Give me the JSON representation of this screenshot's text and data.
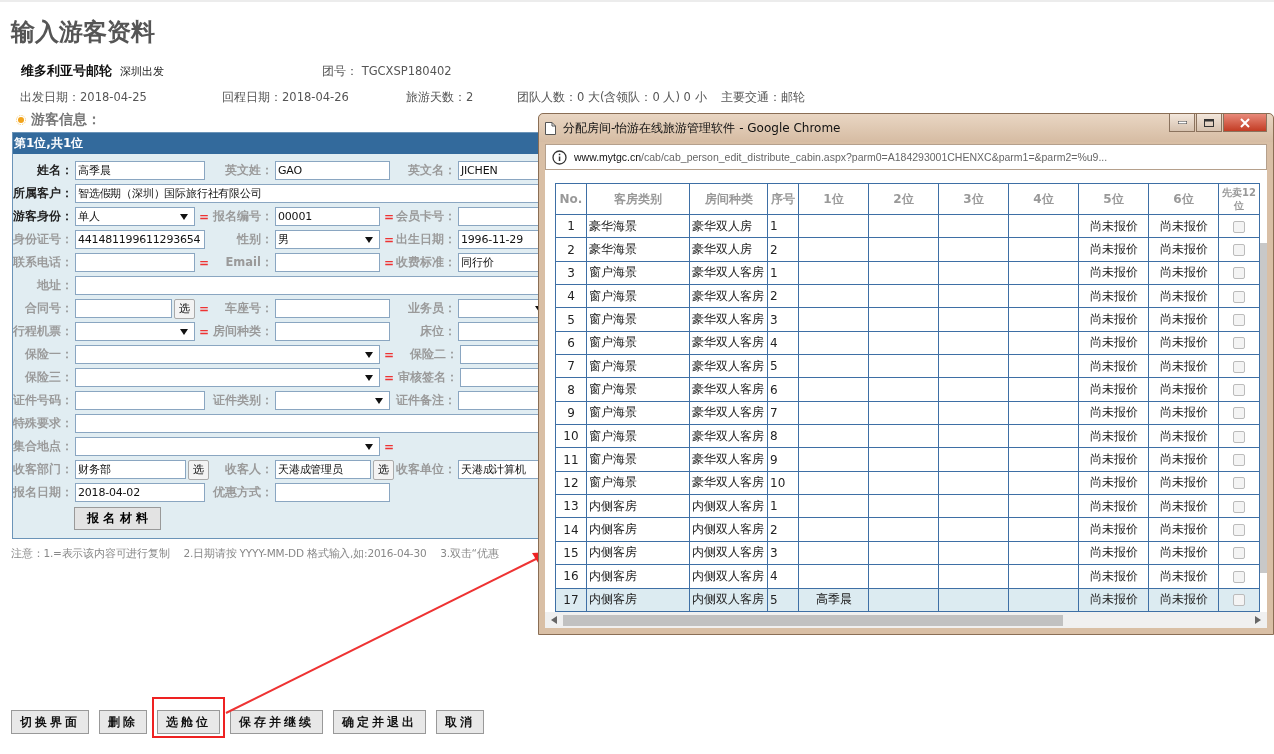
{
  "page_title": "输入游客资料",
  "tour": {
    "ship": "维多利亚号邮轮",
    "departure_city": "深圳出发",
    "group_no": "团号： TGCXSP180402",
    "facts": [
      "出发日期：2018-04-25",
      "回程日期：2018-04-26",
      "旅游天数：2",
      "团队人数：0 大(含领队：0 人) 0 小",
      "主要交通：邮轮"
    ]
  },
  "section_title": "游客信息：",
  "form": {
    "header": "第1位,共1位",
    "rows": [
      [
        {
          "label": "姓名：",
          "required": true,
          "kind": "text",
          "value": "高季晨"
        },
        {
          "label": "英文姓：",
          "required": false,
          "kind": "text",
          "value": "GAO"
        },
        {
          "label": "英文名：",
          "required": false,
          "kind": "text",
          "value": "JICHEN"
        }
      ],
      [
        {
          "label": "所属客户：",
          "required": true,
          "kind": "long_text",
          "value": "智选假期（深圳）国际旅行社有限公司"
        }
      ],
      [
        {
          "label": "游客身份：",
          "required": true,
          "kind": "select",
          "value": "单人",
          "eq": "="
        },
        {
          "label": "报名编号：",
          "required": false,
          "kind": "text",
          "value": "00001",
          "eq": "="
        },
        {
          "label": "会员卡号：",
          "required": false,
          "kind": "text"
        }
      ],
      [
        {
          "label": "身份证号：",
          "required": false,
          "kind": "text",
          "value": "441481199611293654"
        },
        {
          "label": "性别：",
          "required": false,
          "kind": "select",
          "value": "男",
          "eq": "="
        },
        {
          "label": "出生日期：",
          "required": false,
          "kind": "text",
          "value": "1996-11-29"
        }
      ],
      [
        {
          "label": "联系电话：",
          "required": false,
          "kind": "text",
          "eq": "="
        },
        {
          "label": "Email：",
          "required": false,
          "kind": "text",
          "eq": "="
        },
        {
          "label": "收费标准：",
          "required": false,
          "kind": "text",
          "value": "同行价"
        }
      ],
      [
        {
          "label": "地址：",
          "required": false,
          "kind": "long_text"
        }
      ],
      [
        {
          "label": "合同号：",
          "required": false,
          "kind": "text",
          "pick": "选",
          "eq": "="
        },
        {
          "label": "车座号：",
          "required": false,
          "kind": "text"
        },
        {
          "label": "业务员：",
          "required": false,
          "kind": "select"
        }
      ],
      [
        {
          "label": "行程机票：",
          "required": false,
          "kind": "select",
          "eq": "="
        },
        {
          "label": "房间种类：",
          "required": false,
          "kind": "text"
        },
        {
          "label": "床位：",
          "required": false,
          "kind": "text"
        }
      ],
      [
        {
          "label": "保险一：",
          "required": false,
          "kind": "long_select",
          "eq": "="
        },
        {
          "label": "保险二：",
          "required": false,
          "kind": "text"
        }
      ],
      [
        {
          "label": "保险三：",
          "required": false,
          "kind": "long_select",
          "eq": "="
        },
        {
          "label": "审核签名：",
          "required": false,
          "kind": "text"
        }
      ],
      [
        {
          "label": "证件号码：",
          "required": false,
          "kind": "text"
        },
        {
          "label": "证件类别：",
          "required": false,
          "kind": "select"
        },
        {
          "label": "证件备注：",
          "required": false,
          "kind": "text"
        }
      ],
      [
        {
          "label": "特殊要求：",
          "required": false,
          "kind": "long_text"
        }
      ],
      [
        {
          "label": "集合地点：",
          "required": false,
          "kind": "long_select",
          "eq": "="
        }
      ],
      [
        {
          "label": "收客部门：",
          "required": false,
          "kind": "text",
          "value": "财务部",
          "pick": "选"
        },
        {
          "label": "收客人：",
          "required": false,
          "kind": "text",
          "value": "天港成管理员",
          "pick": "选"
        },
        {
          "label": "收客单位：",
          "required": false,
          "kind": "text",
          "value": "天港成计算机"
        }
      ],
      [
        {
          "label": "报名日期：",
          "required": false,
          "kind": "text",
          "value": "2018-04-02"
        },
        {
          "label": "优惠方式：",
          "required": false,
          "kind": "text"
        }
      ]
    ],
    "materials_button": "报 名 材 料"
  },
  "note": "注意：1.=表示该内容可进行复制　 2.日期请按 YYYY-MM-DD 格式输入,如:2016-04-30　 3.双击“优惠",
  "buttons": [
    {
      "label": "切换界面",
      "highlighted": false
    },
    {
      "label": "删除",
      "highlighted": false
    },
    {
      "label": "选舱位",
      "highlighted": true
    },
    {
      "label": "保存并继续",
      "highlighted": false
    },
    {
      "label": "确定并退出",
      "highlighted": false
    },
    {
      "label": "取消",
      "highlighted": false
    }
  ],
  "popup": {
    "title": "分配房间-怡游在线旅游管理软件 - Google Chrome",
    "url_host": "www.mytgc.cn",
    "url_path": "/cab/cab_person_edit_distribute_cabin.aspx?parm0=A184293001CHENXC&parm1=&parm2=%u9...",
    "columns": [
      "No.",
      "客房类别",
      "房间种类",
      "序号",
      "1位",
      "2位",
      "3位",
      "4位",
      "5位",
      "6位",
      "先卖12位"
    ],
    "rows": [
      {
        "no": "1",
        "room_class": "豪华海景",
        "room_type": "豪华双人房",
        "seq": "1",
        "price_5": "尚未报价",
        "price_6": "尚未报价",
        "checked": false,
        "selected": false
      },
      {
        "no": "2",
        "room_class": "豪华海景",
        "room_type": "豪华双人房",
        "seq": "2",
        "price_5": "尚未报价",
        "price_6": "尚未报价",
        "checked": false,
        "selected": false
      },
      {
        "no": "3",
        "room_class": "窗户海景",
        "room_type": "豪华双人客房",
        "seq": "1",
        "price_5": "尚未报价",
        "price_6": "尚未报价",
        "checked": false,
        "selected": false
      },
      {
        "no": "4",
        "room_class": "窗户海景",
        "room_type": "豪华双人客房",
        "seq": "2",
        "price_5": "尚未报价",
        "price_6": "尚未报价",
        "checked": false,
        "selected": false
      },
      {
        "no": "5",
        "room_class": "窗户海景",
        "room_type": "豪华双人客房",
        "seq": "3",
        "price_5": "尚未报价",
        "price_6": "尚未报价",
        "checked": false,
        "selected": false
      },
      {
        "no": "6",
        "room_class": "窗户海景",
        "room_type": "豪华双人客房",
        "seq": "4",
        "price_5": "尚未报价",
        "price_6": "尚未报价",
        "checked": false,
        "selected": false
      },
      {
        "no": "7",
        "room_class": "窗户海景",
        "room_type": "豪华双人客房",
        "seq": "5",
        "price_5": "尚未报价",
        "price_6": "尚未报价",
        "checked": false,
        "selected": false
      },
      {
        "no": "8",
        "room_class": "窗户海景",
        "room_type": "豪华双人客房",
        "seq": "6",
        "price_5": "尚未报价",
        "price_6": "尚未报价",
        "checked": false,
        "selected": false
      },
      {
        "no": "9",
        "room_class": "窗户海景",
        "room_type": "豪华双人客房",
        "seq": "7",
        "price_5": "尚未报价",
        "price_6": "尚未报价",
        "checked": false,
        "selected": false
      },
      {
        "no": "10",
        "room_class": "窗户海景",
        "room_type": "豪华双人客房",
        "seq": "8",
        "price_5": "尚未报价",
        "price_6": "尚未报价",
        "checked": false,
        "selected": false
      },
      {
        "no": "11",
        "room_class": "窗户海景",
        "room_type": "豪华双人客房",
        "seq": "9",
        "price_5": "尚未报价",
        "price_6": "尚未报价",
        "checked": false,
        "selected": false
      },
      {
        "no": "12",
        "room_class": "窗户海景",
        "room_type": "豪华双人客房",
        "seq": "10",
        "price_5": "尚未报价",
        "price_6": "尚未报价",
        "checked": false,
        "selected": false
      },
      {
        "no": "13",
        "room_class": "内侧客房",
        "room_type": "内侧双人客房",
        "seq": "1",
        "price_5": "尚未报价",
        "price_6": "尚未报价",
        "checked": false,
        "selected": false
      },
      {
        "no": "14",
        "room_class": "内侧客房",
        "room_type": "内侧双人客房",
        "seq": "2",
        "price_5": "尚未报价",
        "price_6": "尚未报价",
        "checked": false,
        "selected": false
      },
      {
        "no": "15",
        "room_class": "内侧客房",
        "room_type": "内侧双人客房",
        "seq": "3",
        "price_5": "尚未报价",
        "price_6": "尚未报价",
        "checked": false,
        "selected": false
      },
      {
        "no": "16",
        "room_class": "内侧客房",
        "room_type": "内侧双人客房",
        "seq": "4",
        "price_5": "尚未报价",
        "price_6": "尚未报价",
        "checked": false,
        "selected": false
      },
      {
        "no": "17",
        "room_class": "内侧客房",
        "room_type": "内侧双人客房",
        "seq": "5",
        "occupant_1": "高季晨",
        "price_5": "尚未报价",
        "price_6": "尚未报价",
        "checked": false,
        "selected": true
      }
    ]
  }
}
